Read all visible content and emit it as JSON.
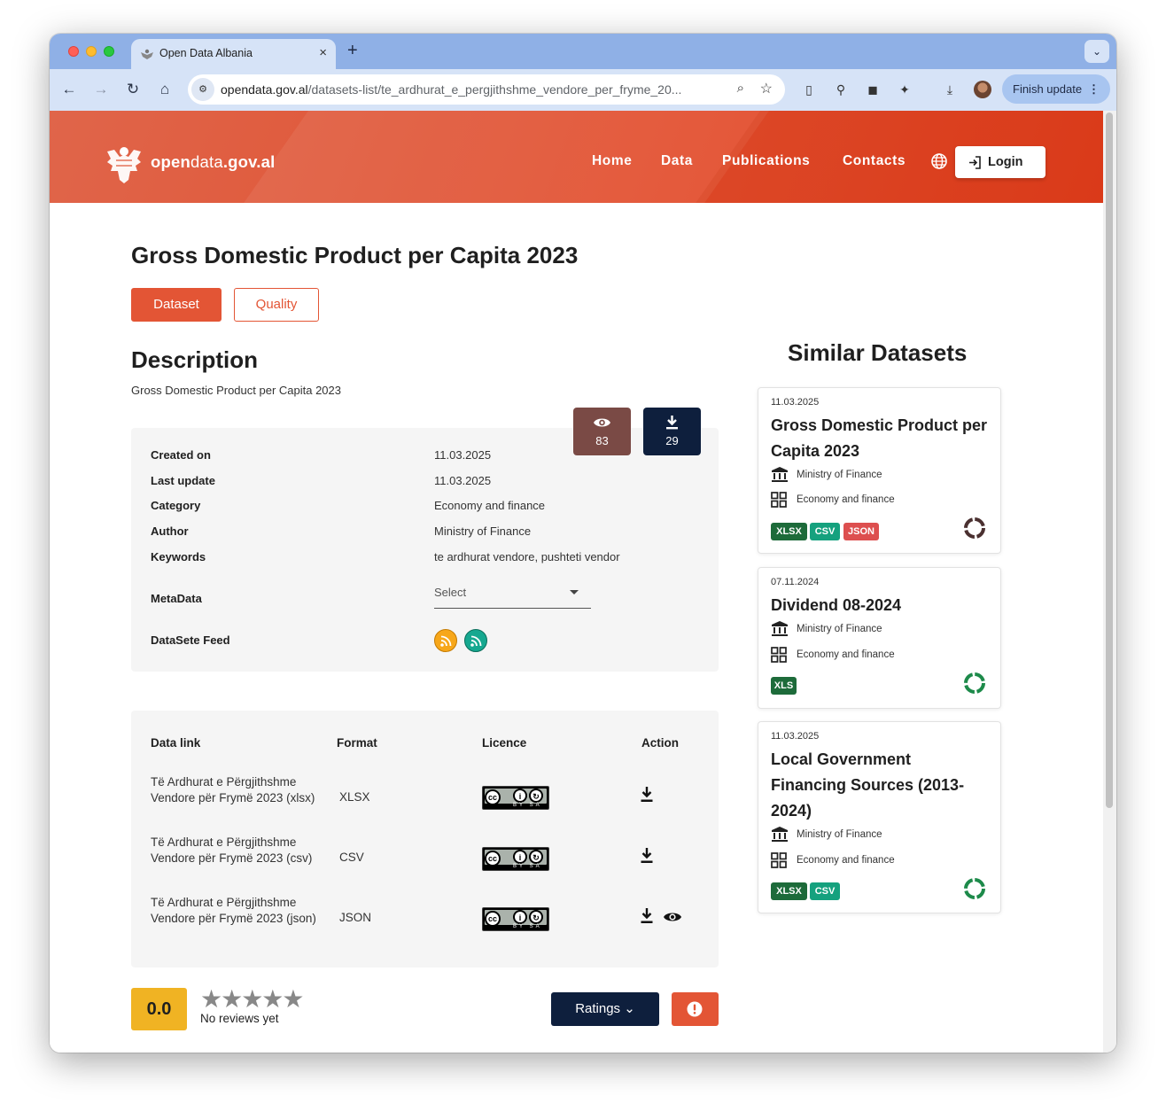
{
  "browser": {
    "tab_title": "Open Data Albania",
    "tab_close": "×",
    "new_tab": "+",
    "url_host": "opendata.gov.al",
    "url_path": "/datasets-list/te_ardhurat_e_pergjithshme_vendore_per_fryme_20...",
    "finish_update_label": "Finish update"
  },
  "site": {
    "logo_bold": "open",
    "logo_thin": "data",
    "logo_suffix": ".gov.al",
    "nav": [
      "Home",
      "Data",
      "Publications",
      "Contacts"
    ],
    "login_label": "Login",
    "colors": {
      "brand": "#e35535",
      "navy": "#0e1f3d",
      "gold": "#f0b323"
    }
  },
  "dataset": {
    "title": "Gross Domestic Product per Capita 2023",
    "tabs": [
      "Dataset",
      "Quality"
    ],
    "description_heading": "Description",
    "description": "Gross Domestic Product per Capita 2023",
    "views": "83",
    "downloads": "29",
    "meta": [
      {
        "label": "Created on",
        "value": "11.03.2025"
      },
      {
        "label": "Last update",
        "value": "11.03.2025"
      },
      {
        "label": "Category",
        "value": "Economy and finance"
      },
      {
        "label": "Author",
        "value": "Ministry of Finance"
      },
      {
        "label": "Keywords",
        "value": "te ardhurat vendore, pushteti vendor"
      }
    ],
    "metadata_label": "MetaData",
    "metadata_select": "Select",
    "feed_label": "DataSete Feed",
    "links_headers": [
      "Data link",
      "Format",
      "Licence",
      "Action"
    ],
    "links": [
      {
        "name": "Të Ardhurat e Përgjithshme Vendore për Frymë 2023 (xlsx)",
        "format": "XLSX"
      },
      {
        "name": "Të Ardhurat e Përgjithshme Vendore për Frymë 2023 (csv)",
        "format": "CSV"
      },
      {
        "name": "Të Ardhurat e Përgjithshme Vendore për Frymë 2023 (json)",
        "format": "JSON"
      }
    ],
    "cc_tags": "BY SA",
    "rating": "0.0",
    "stars": "★★★★★",
    "no_reviews": "No reviews yet",
    "ratings_button": "Ratings"
  },
  "similar": {
    "heading": "Similar Datasets",
    "cards": [
      {
        "date": "11.03.2025",
        "title": "Gross Domestic Product per Capita 2023",
        "org": "Ministry of Finance",
        "category": "Economy and finance",
        "formats": [
          "XLSX",
          "CSV",
          "JSON"
        ],
        "ring_color": "#4a3030"
      },
      {
        "date": "07.11.2024",
        "title": "Dividend 08-2024",
        "org": "Ministry of Finance",
        "category": "Economy and finance",
        "formats": [
          "XLS"
        ],
        "ring_color": "#1d8a4a"
      },
      {
        "date": "11.03.2025",
        "title": "Local Government Financing Sources (2013-2024)",
        "org": "Ministry of Finance",
        "category": "Economy and finance",
        "formats": [
          "XLSX",
          "CSV"
        ],
        "ring_color": "#1d8a4a"
      }
    ]
  }
}
